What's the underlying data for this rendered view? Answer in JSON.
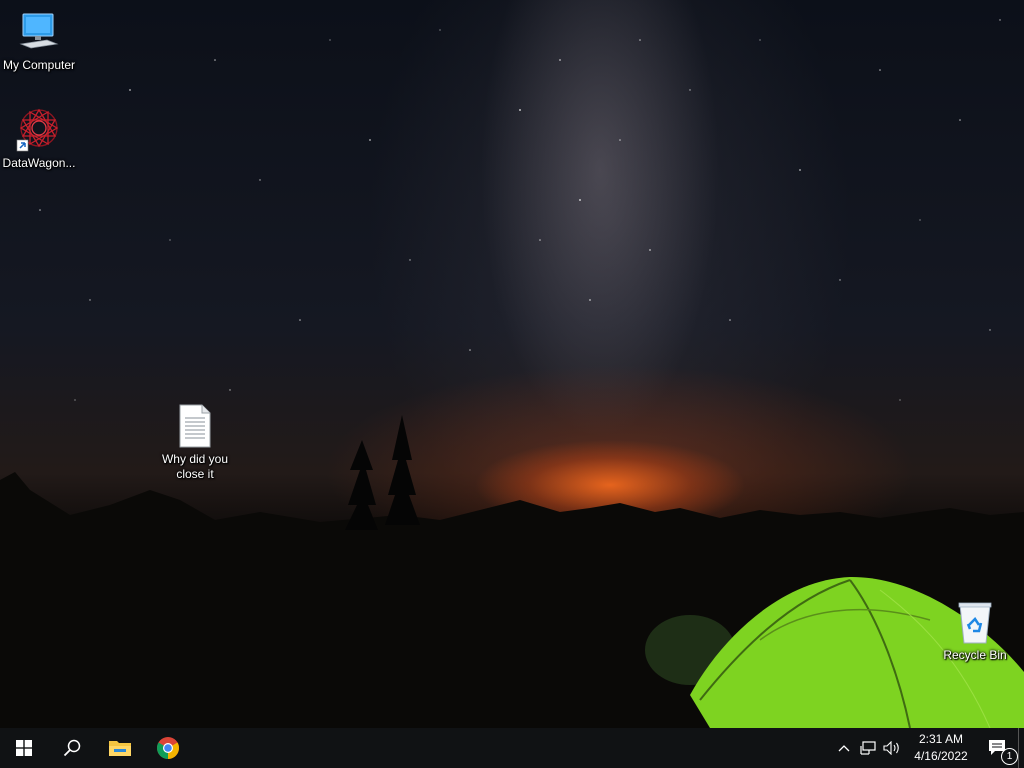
{
  "desktop": {
    "icons": {
      "my_computer": {
        "label": "My Computer",
        "icon": "computer-icon"
      },
      "datawagon": {
        "label": "DataWagon...",
        "icon": "datawagon-shortcut-icon"
      },
      "text_file": {
        "label": "Why did you close it",
        "icon": "text-document-icon"
      },
      "recycle_bin": {
        "label": "Recycle Bin",
        "icon": "recycle-bin-icon"
      }
    }
  },
  "taskbar": {
    "buttons": [
      "windows-start-icon",
      "search-icon",
      "file-explorer-icon",
      "chrome-icon"
    ],
    "tray": {
      "icons": [
        "chevron-up-icon",
        "network-icon",
        "volume-icon"
      ],
      "time": "2:31 AM",
      "date": "4/16/2022",
      "notification_count": "1"
    }
  },
  "colors": {
    "taskbar": "#101214",
    "tent": "#7ed321",
    "sunset": "#ff6a1e"
  }
}
